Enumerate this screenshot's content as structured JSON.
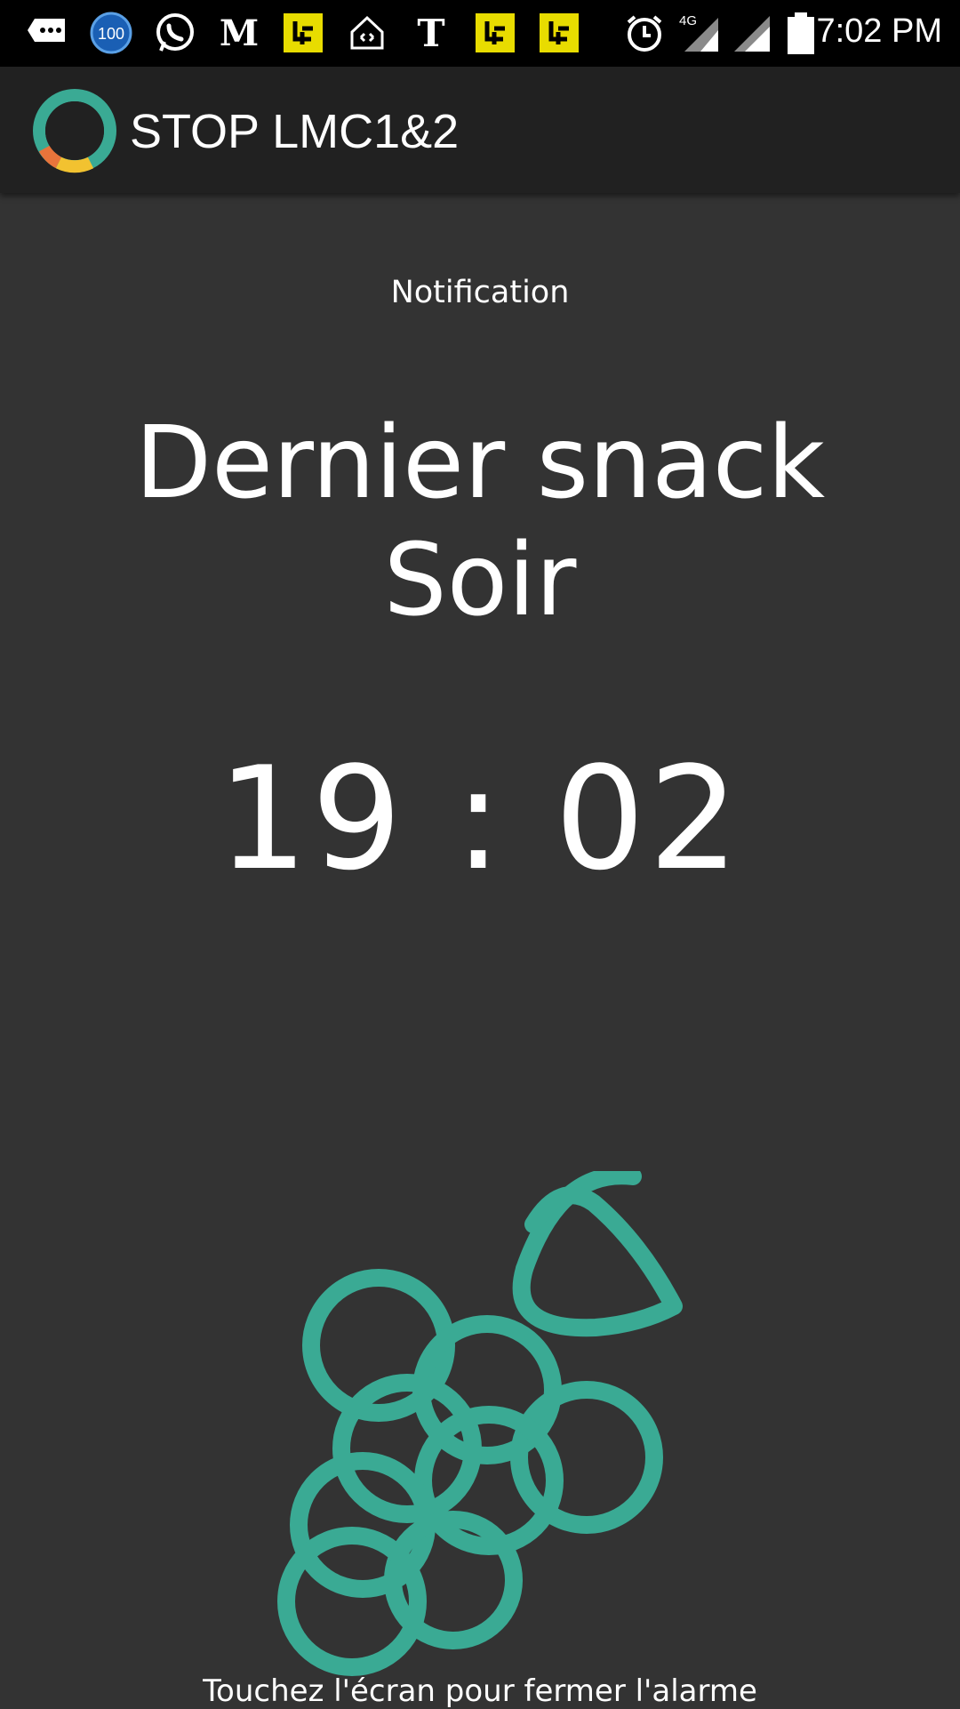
{
  "status_bar": {
    "time": "7:02 PM",
    "network": "4G",
    "badge_count": "100",
    "icons": [
      "messaging-icon",
      "badge-100-icon",
      "whatsapp-icon",
      "le-monde-icon",
      "app-yellow-icon",
      "home-icon",
      "nyt-icon",
      "app-yellow-icon",
      "app-yellow-icon",
      "alarm-icon",
      "signal-4g-icon",
      "signal-icon",
      "battery-icon"
    ]
  },
  "app_bar": {
    "title": "STOP LMC1&2",
    "logo_icon": "app-ring-logo-icon"
  },
  "notification": {
    "label": "Notification",
    "title_line1": "Dernier snack",
    "title_line2": "Soir",
    "time": "19 : 02",
    "illustration_icon": "grapes-icon",
    "dismiss_hint": "Touchez l'écran pour fermer l'alarme"
  },
  "colors": {
    "background": "#333333",
    "app_bar": "#212121",
    "status_bar": "#000000",
    "accent_teal": "#3aaa94",
    "ring_orange": "#e8743b",
    "ring_yellow": "#f2c230"
  }
}
